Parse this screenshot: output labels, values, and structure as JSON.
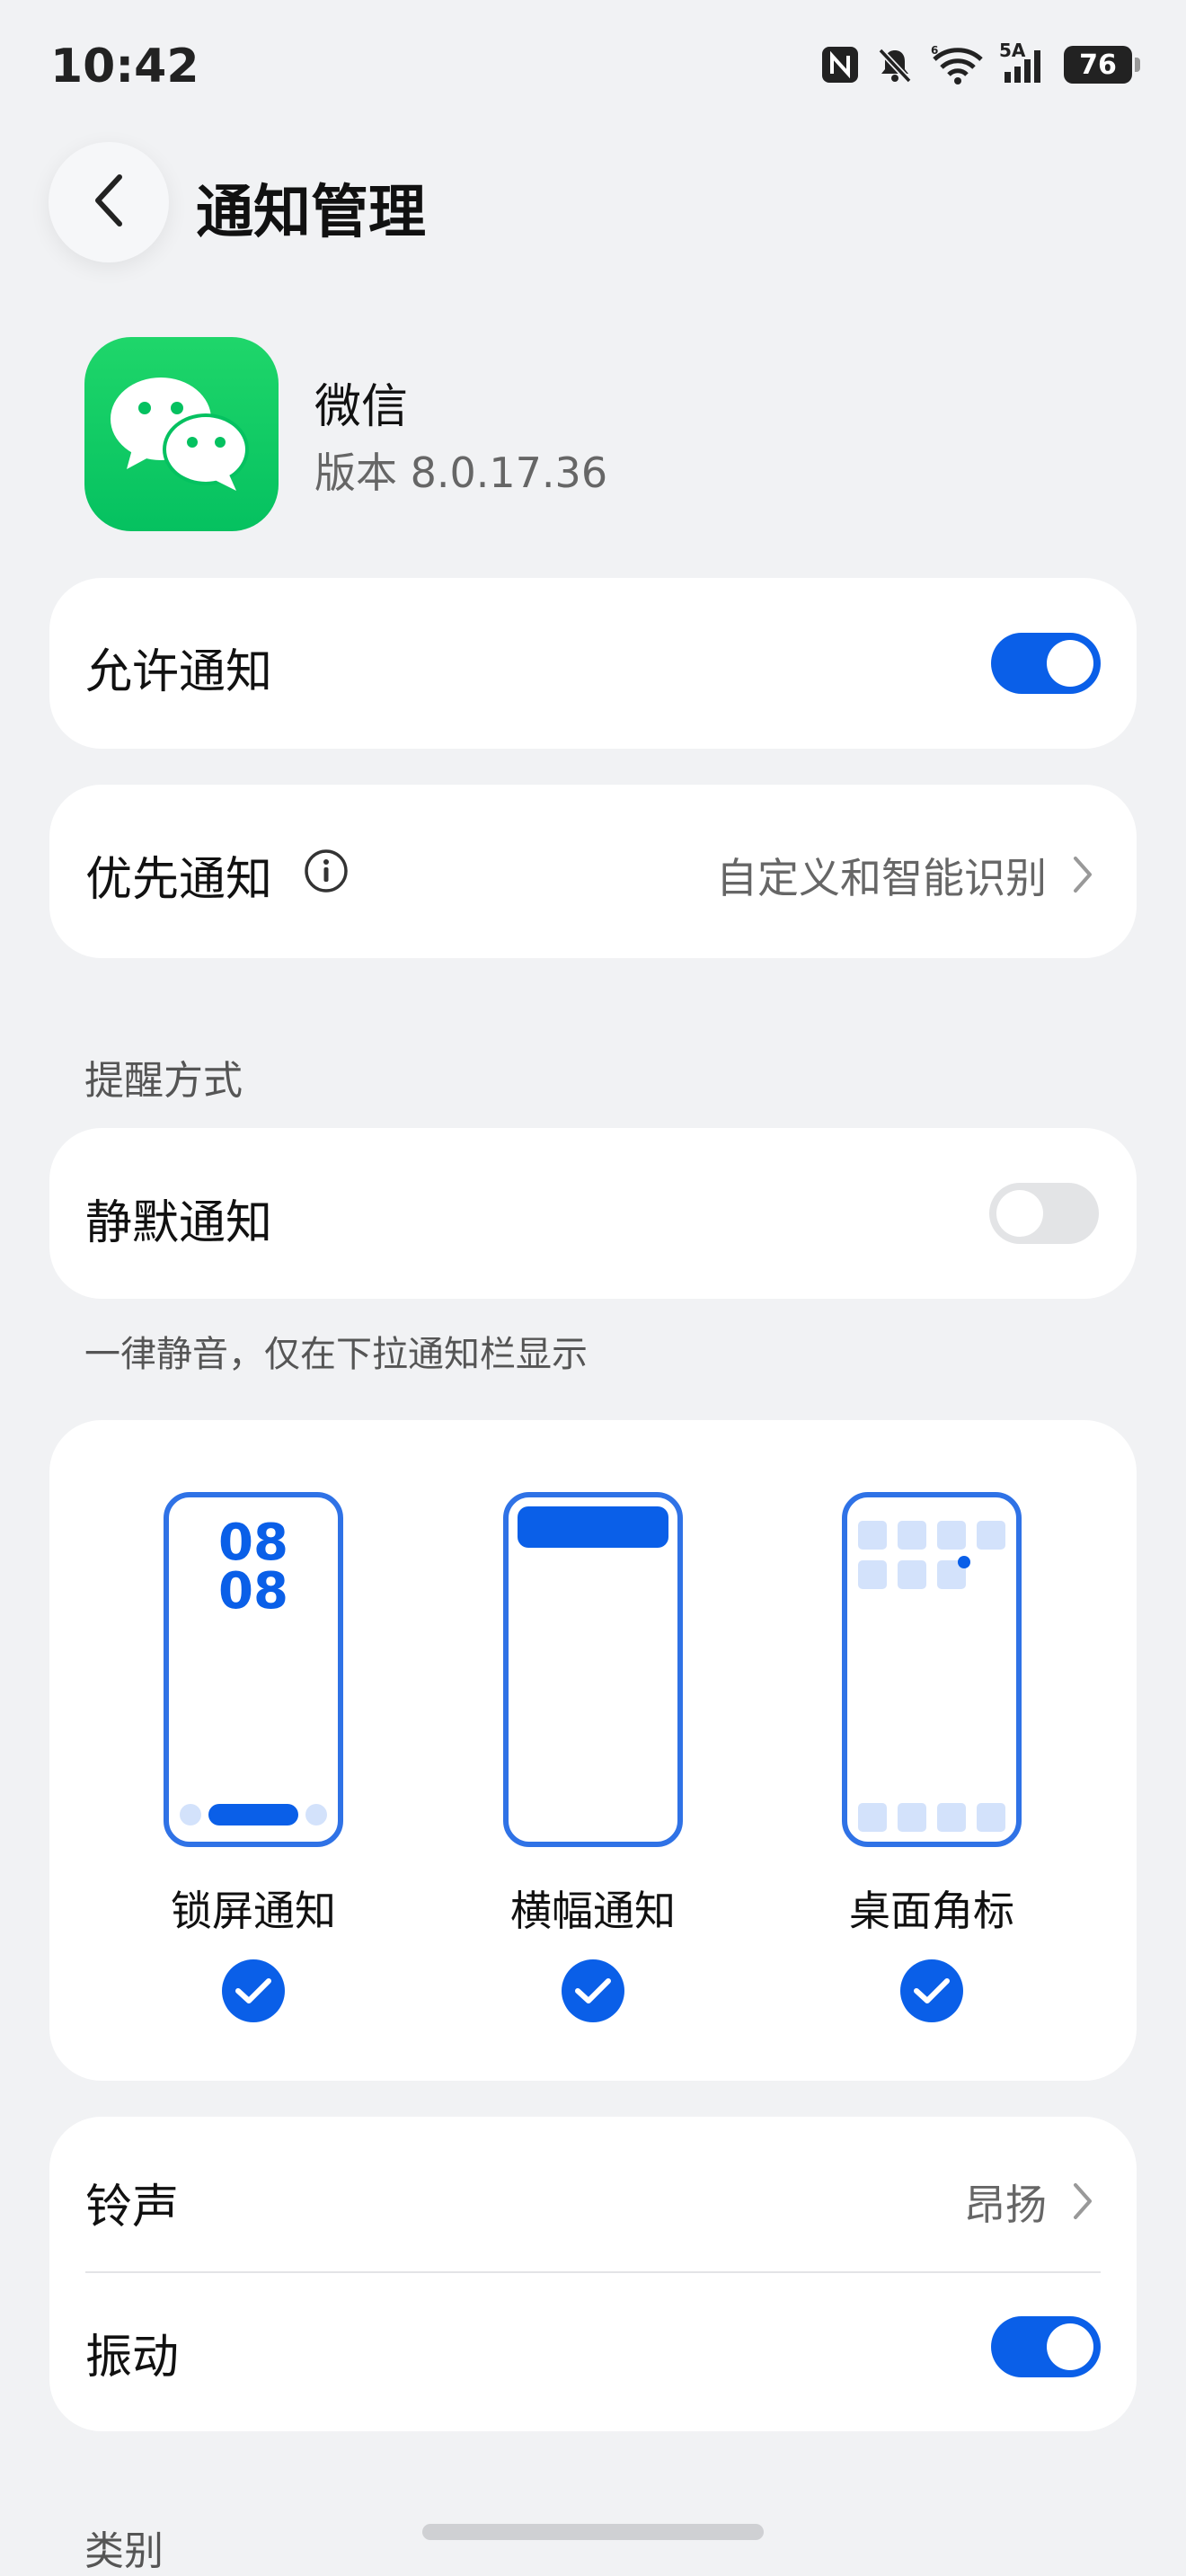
{
  "status_bar": {
    "time": "10:42",
    "network_label": "5A",
    "battery": "76",
    "icons": [
      "nfc-icon",
      "bell-muted-icon",
      "wifi-icon",
      "signal-icon",
      "battery-icon"
    ]
  },
  "header": {
    "title": "通知管理",
    "back_icon": "chevron-left-icon"
  },
  "app": {
    "name": "微信",
    "version": "版本 8.0.17.36",
    "icon": "wechat-icon"
  },
  "allow_notifications": {
    "label": "允许通知",
    "enabled": true
  },
  "priority_notifications": {
    "label": "优先通知",
    "value": "自定义和智能识别",
    "info_icon": "info-icon"
  },
  "reminder_section": {
    "title": "提醒方式",
    "silent": {
      "label": "静默通知",
      "enabled": false
    },
    "silent_hint": "一律静音，仅在下拉通知栏显示",
    "options": [
      {
        "label": "锁屏通知",
        "checked": true,
        "clock_digits": "08"
      },
      {
        "label": "横幅通知",
        "checked": true
      },
      {
        "label": "桌面角标",
        "checked": true
      }
    ]
  },
  "sound_card": {
    "ringtone": {
      "label": "铃声",
      "value": "昂扬"
    },
    "vibration": {
      "label": "振动",
      "enabled": true
    }
  },
  "category_section": {
    "title": "类别"
  },
  "colors": {
    "accent": "#0a5fe8",
    "background": "#f1f2f4",
    "card": "#ffffff",
    "wechat_green": "#07c160"
  }
}
